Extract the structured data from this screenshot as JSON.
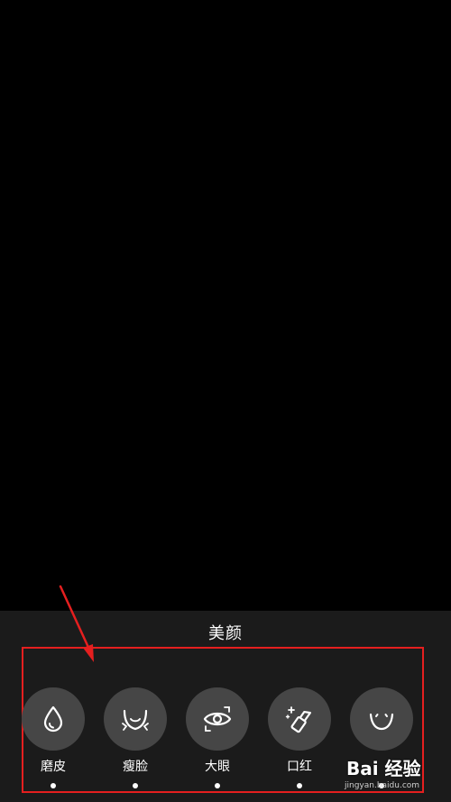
{
  "panel": {
    "title": "美颜"
  },
  "tools": [
    {
      "label": "磨皮",
      "icon": "droplet-icon"
    },
    {
      "label": "瘦脸",
      "icon": "face-slim-icon"
    },
    {
      "label": "大眼",
      "icon": "eye-icon"
    },
    {
      "label": "口红",
      "icon": "lipstick-icon"
    },
    {
      "label": "",
      "icon": "smile-icon"
    }
  ],
  "watermark": {
    "logo": "Bai 经验",
    "sub": "jingyan.baidu.com"
  },
  "colors": {
    "panel_bg": "#1b1b1b",
    "tool_circle": "#464646",
    "highlight": "#e51f1f",
    "arrow": "#e51f1f"
  }
}
